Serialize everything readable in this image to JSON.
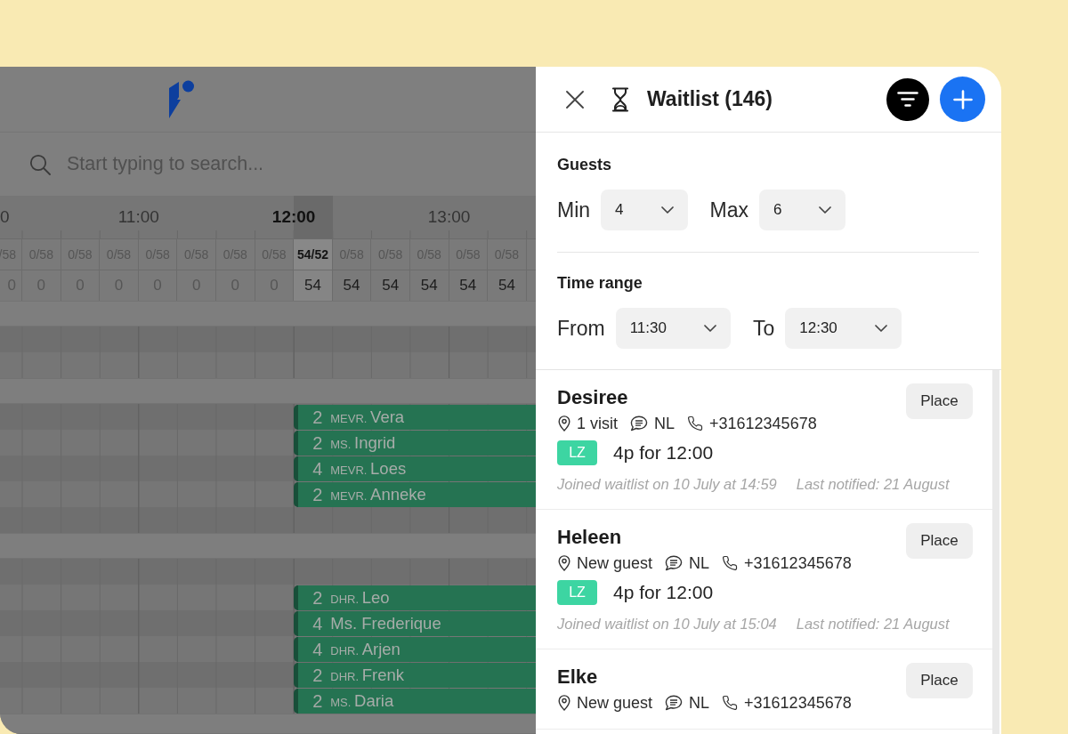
{
  "timeline": {
    "search": {
      "placeholder": "Start typing to search..."
    },
    "hours": [
      {
        "label": "0",
        "current": false
      },
      {
        "label": "11:00",
        "current": false
      },
      {
        "label": "12:00",
        "current": true
      },
      {
        "label": "13:00",
        "current": false
      }
    ],
    "slots": [
      {
        "capacity": "/58",
        "count": "0",
        "current": false,
        "filled": false
      },
      {
        "capacity": "0/58",
        "count": "0",
        "current": false,
        "filled": false
      },
      {
        "capacity": "0/58",
        "count": "0",
        "current": false,
        "filled": false
      },
      {
        "capacity": "0/58",
        "count": "0",
        "current": false,
        "filled": false
      },
      {
        "capacity": "0/58",
        "count": "0",
        "current": false,
        "filled": false
      },
      {
        "capacity": "0/58",
        "count": "0",
        "current": false,
        "filled": false
      },
      {
        "capacity": "0/58",
        "count": "0",
        "current": false,
        "filled": false
      },
      {
        "capacity": "0/58",
        "count": "0",
        "current": false,
        "filled": false
      },
      {
        "capacity": "54/52",
        "count": "54",
        "current": true,
        "filled": true
      },
      {
        "capacity": "0/58",
        "count": "54",
        "current": false,
        "filled": true
      },
      {
        "capacity": "0/58",
        "count": "54",
        "current": false,
        "filled": true
      },
      {
        "capacity": "0/58",
        "count": "54",
        "current": false,
        "filled": true
      },
      {
        "capacity": "0/58",
        "count": "54",
        "current": false,
        "filled": true
      },
      {
        "capacity": "0/58",
        "count": "54",
        "current": false,
        "filled": true
      }
    ],
    "sections": [
      {
        "rows": [
          {
            "kind": "empty"
          },
          {
            "kind": "empty"
          }
        ]
      },
      {
        "rows": [
          {
            "kind": "booking",
            "guests": "2",
            "salutation": "MEVR.",
            "name": "Vera"
          },
          {
            "kind": "booking",
            "guests": "2",
            "salutation": "MS.",
            "name": "Ingrid"
          },
          {
            "kind": "booking",
            "guests": "4",
            "salutation": "MEVR.",
            "name": "Loes"
          },
          {
            "kind": "booking",
            "guests": "2",
            "salutation": "MEVR.",
            "name": "Anneke"
          },
          {
            "kind": "empty"
          }
        ]
      },
      {
        "rows": [
          {
            "kind": "empty"
          },
          {
            "kind": "booking",
            "guests": "2",
            "salutation": "DHR.",
            "name": "Leo"
          },
          {
            "kind": "booking",
            "guests": "4",
            "name": "Ms. Frederique"
          },
          {
            "kind": "booking",
            "guests": "4",
            "salutation": "DHR.",
            "name": "Arjen"
          },
          {
            "kind": "booking",
            "guests": "2",
            "salutation": "DHR.",
            "name": "Frenk"
          },
          {
            "kind": "booking",
            "guests": "2",
            "salutation": "MS.",
            "name": "Daria"
          }
        ]
      }
    ]
  },
  "waitlist": {
    "title": "Waitlist (146)",
    "filter_groups": [
      {
        "heading": "Guests",
        "fields": [
          {
            "label": "Min",
            "value": "4"
          },
          {
            "label": "Max",
            "value": "6"
          }
        ]
      },
      {
        "heading": "Time range",
        "fields": [
          {
            "label": "From",
            "value": "11:30"
          },
          {
            "label": "To",
            "value": "12:30"
          }
        ]
      }
    ],
    "entries": [
      {
        "name": "Desiree",
        "visits": "1 visit",
        "language": "NL",
        "phone": "+31612345678",
        "badge": "LZ",
        "party": "4p for 12:00",
        "joined": "Joined waitlist on 10 July at 14:59",
        "last_notified": "Last notified: 21 August",
        "action": "Place"
      },
      {
        "name": "Heleen",
        "visits": "New guest",
        "language": "NL",
        "phone": "+31612345678",
        "badge": "LZ",
        "party": "4p for 12:00",
        "joined": "Joined waitlist on 10 July at 15:04",
        "last_notified": "Last notified: 21 August",
        "action": "Place"
      },
      {
        "name": "Elke",
        "visits": "New guest",
        "language": "NL",
        "phone": "+31612345678",
        "action": "Place"
      }
    ]
  }
}
